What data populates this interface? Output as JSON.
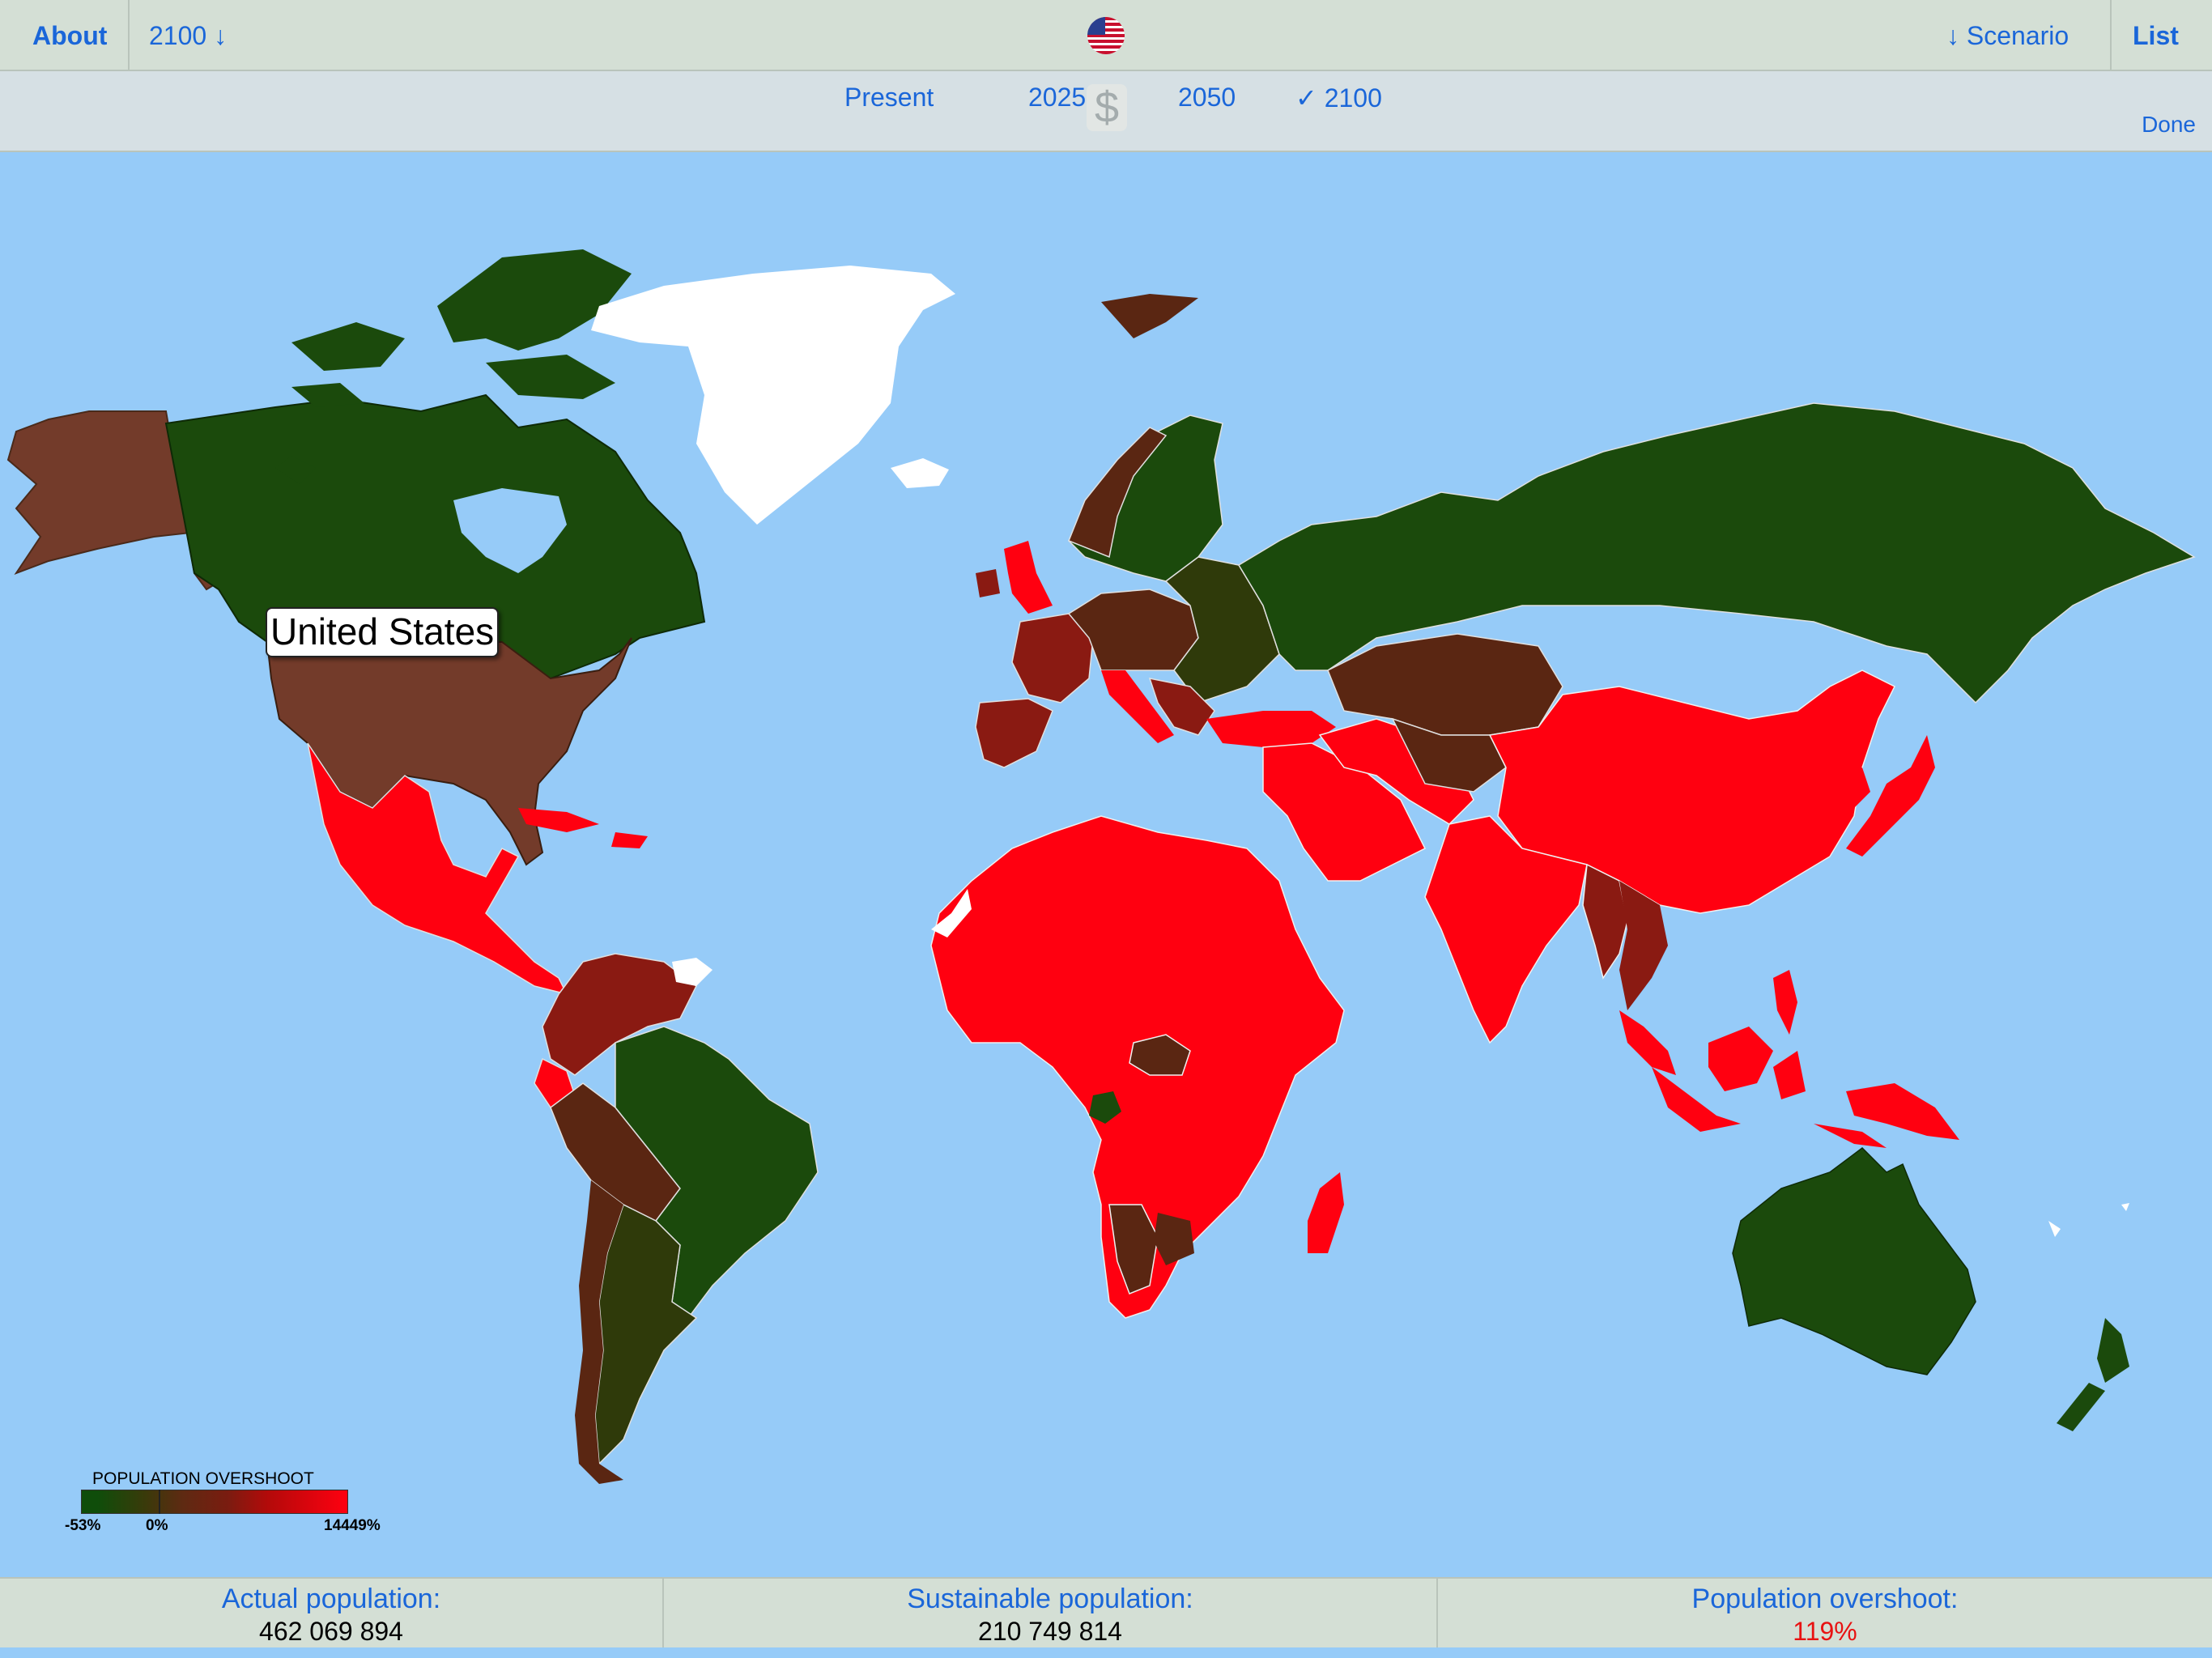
{
  "topbar": {
    "about_label": "About",
    "year_dropdown_label": "2100 ↓",
    "scenario_label": "↓ Scenario",
    "list_label": "List",
    "flag_icon": "us-flag-icon"
  },
  "year_selector": {
    "options": [
      "Present",
      "2025",
      "2050",
      "✓ 2100"
    ],
    "selected": "2100",
    "currency_icon": "$",
    "done_label": "Done"
  },
  "map": {
    "tooltip": "United States",
    "colors": {
      "ocean": "#96cbf8",
      "dark_green": "#1b4a0c",
      "olive": "#2f3a0a",
      "brown": "#733b2a",
      "dark_brown": "#5a2612",
      "dark_red": "#8a1a12",
      "red": "#ff0010",
      "white": "#ffffff"
    }
  },
  "legend": {
    "title": "POPULATION OVERSHOOT",
    "min_label": "-53%",
    "mid_label": "0%",
    "max_label": "14449%"
  },
  "stats": {
    "actual_label": "Actual population:",
    "actual_value": "462 069 894",
    "sustainable_label": "Sustainable population:",
    "sustainable_value": "210 749 814",
    "overshoot_label": "Population overshoot:",
    "overshoot_value": "119%",
    "overshoot_color": "#e81212"
  }
}
